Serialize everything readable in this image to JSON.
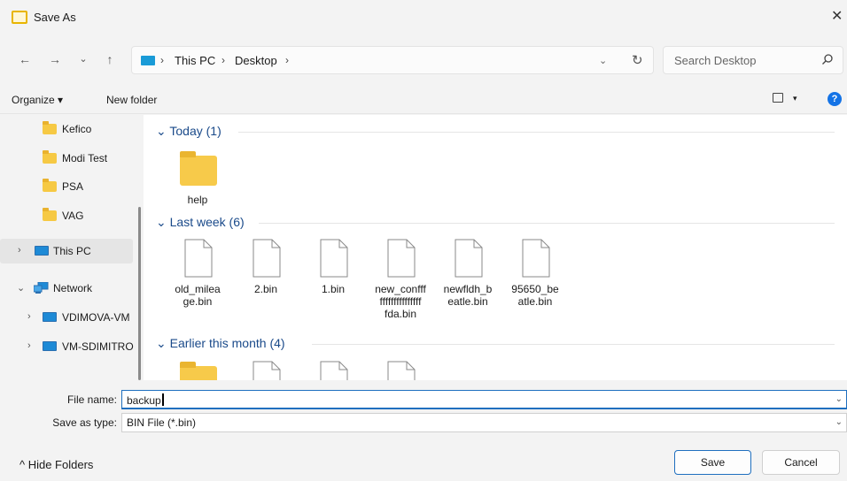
{
  "window": {
    "title": "Save As",
    "close_glyph": "✕",
    "icon": "folder-outline-icon"
  },
  "nav": {
    "back": "←",
    "forward": "→",
    "recent": "⌄",
    "up": "↑"
  },
  "address": {
    "crumbs": [
      "This PC",
      "Desktop"
    ],
    "separator": "›",
    "dropdown": "⌄",
    "refresh": "↻"
  },
  "search": {
    "placeholder": "Search Desktop"
  },
  "toolbar": {
    "organize": "Organize ▾",
    "new_folder": "New folder",
    "view_caret": "▾",
    "help": "?"
  },
  "sidebar": {
    "items": [
      {
        "label": "Kefico"
      },
      {
        "label": "Modi Test"
      },
      {
        "label": "PSA"
      },
      {
        "label": "VAG"
      },
      {
        "label": "This PC",
        "chevron": "›"
      },
      {
        "label": "Network",
        "chevron": "⌄"
      },
      {
        "label": "VDIMOVA-VM",
        "chevron": "›"
      },
      {
        "label": "VM-SDIMITRO",
        "chevron": "›"
      }
    ]
  },
  "groups": [
    {
      "header": "Today (1)",
      "chevron": "⌄",
      "items": [
        {
          "label": "help",
          "type": "folder"
        }
      ]
    },
    {
      "header": "Last week (6)",
      "chevron": "⌄",
      "items": [
        {
          "label": "old_milea\nge.bin",
          "type": "file"
        },
        {
          "label": "2.bin",
          "type": "file"
        },
        {
          "label": "1.bin",
          "type": "file"
        },
        {
          "label": "new_confff\nfffffffffffffff\nfda.bin",
          "type": "file"
        },
        {
          "label": "newfldh_b\neatle.bin",
          "type": "file"
        },
        {
          "label": "95650_be\natle.bin",
          "type": "file"
        }
      ]
    },
    {
      "header": "Earlier this month (4)",
      "chevron": "⌄",
      "items": [
        {
          "label": "",
          "type": "folder"
        },
        {
          "label": "",
          "type": "file"
        },
        {
          "label": "",
          "type": "file"
        },
        {
          "label": "",
          "type": "file"
        }
      ]
    }
  ],
  "form": {
    "file_name_label": "File name:",
    "file_name_value": "backup",
    "save_type_label": "Save as type:",
    "save_type_value": "BIN File (*.bin)",
    "dropdown": "⌄"
  },
  "footer": {
    "hide_folders": "^  Hide Folders",
    "save": "Save",
    "cancel": "Cancel"
  }
}
